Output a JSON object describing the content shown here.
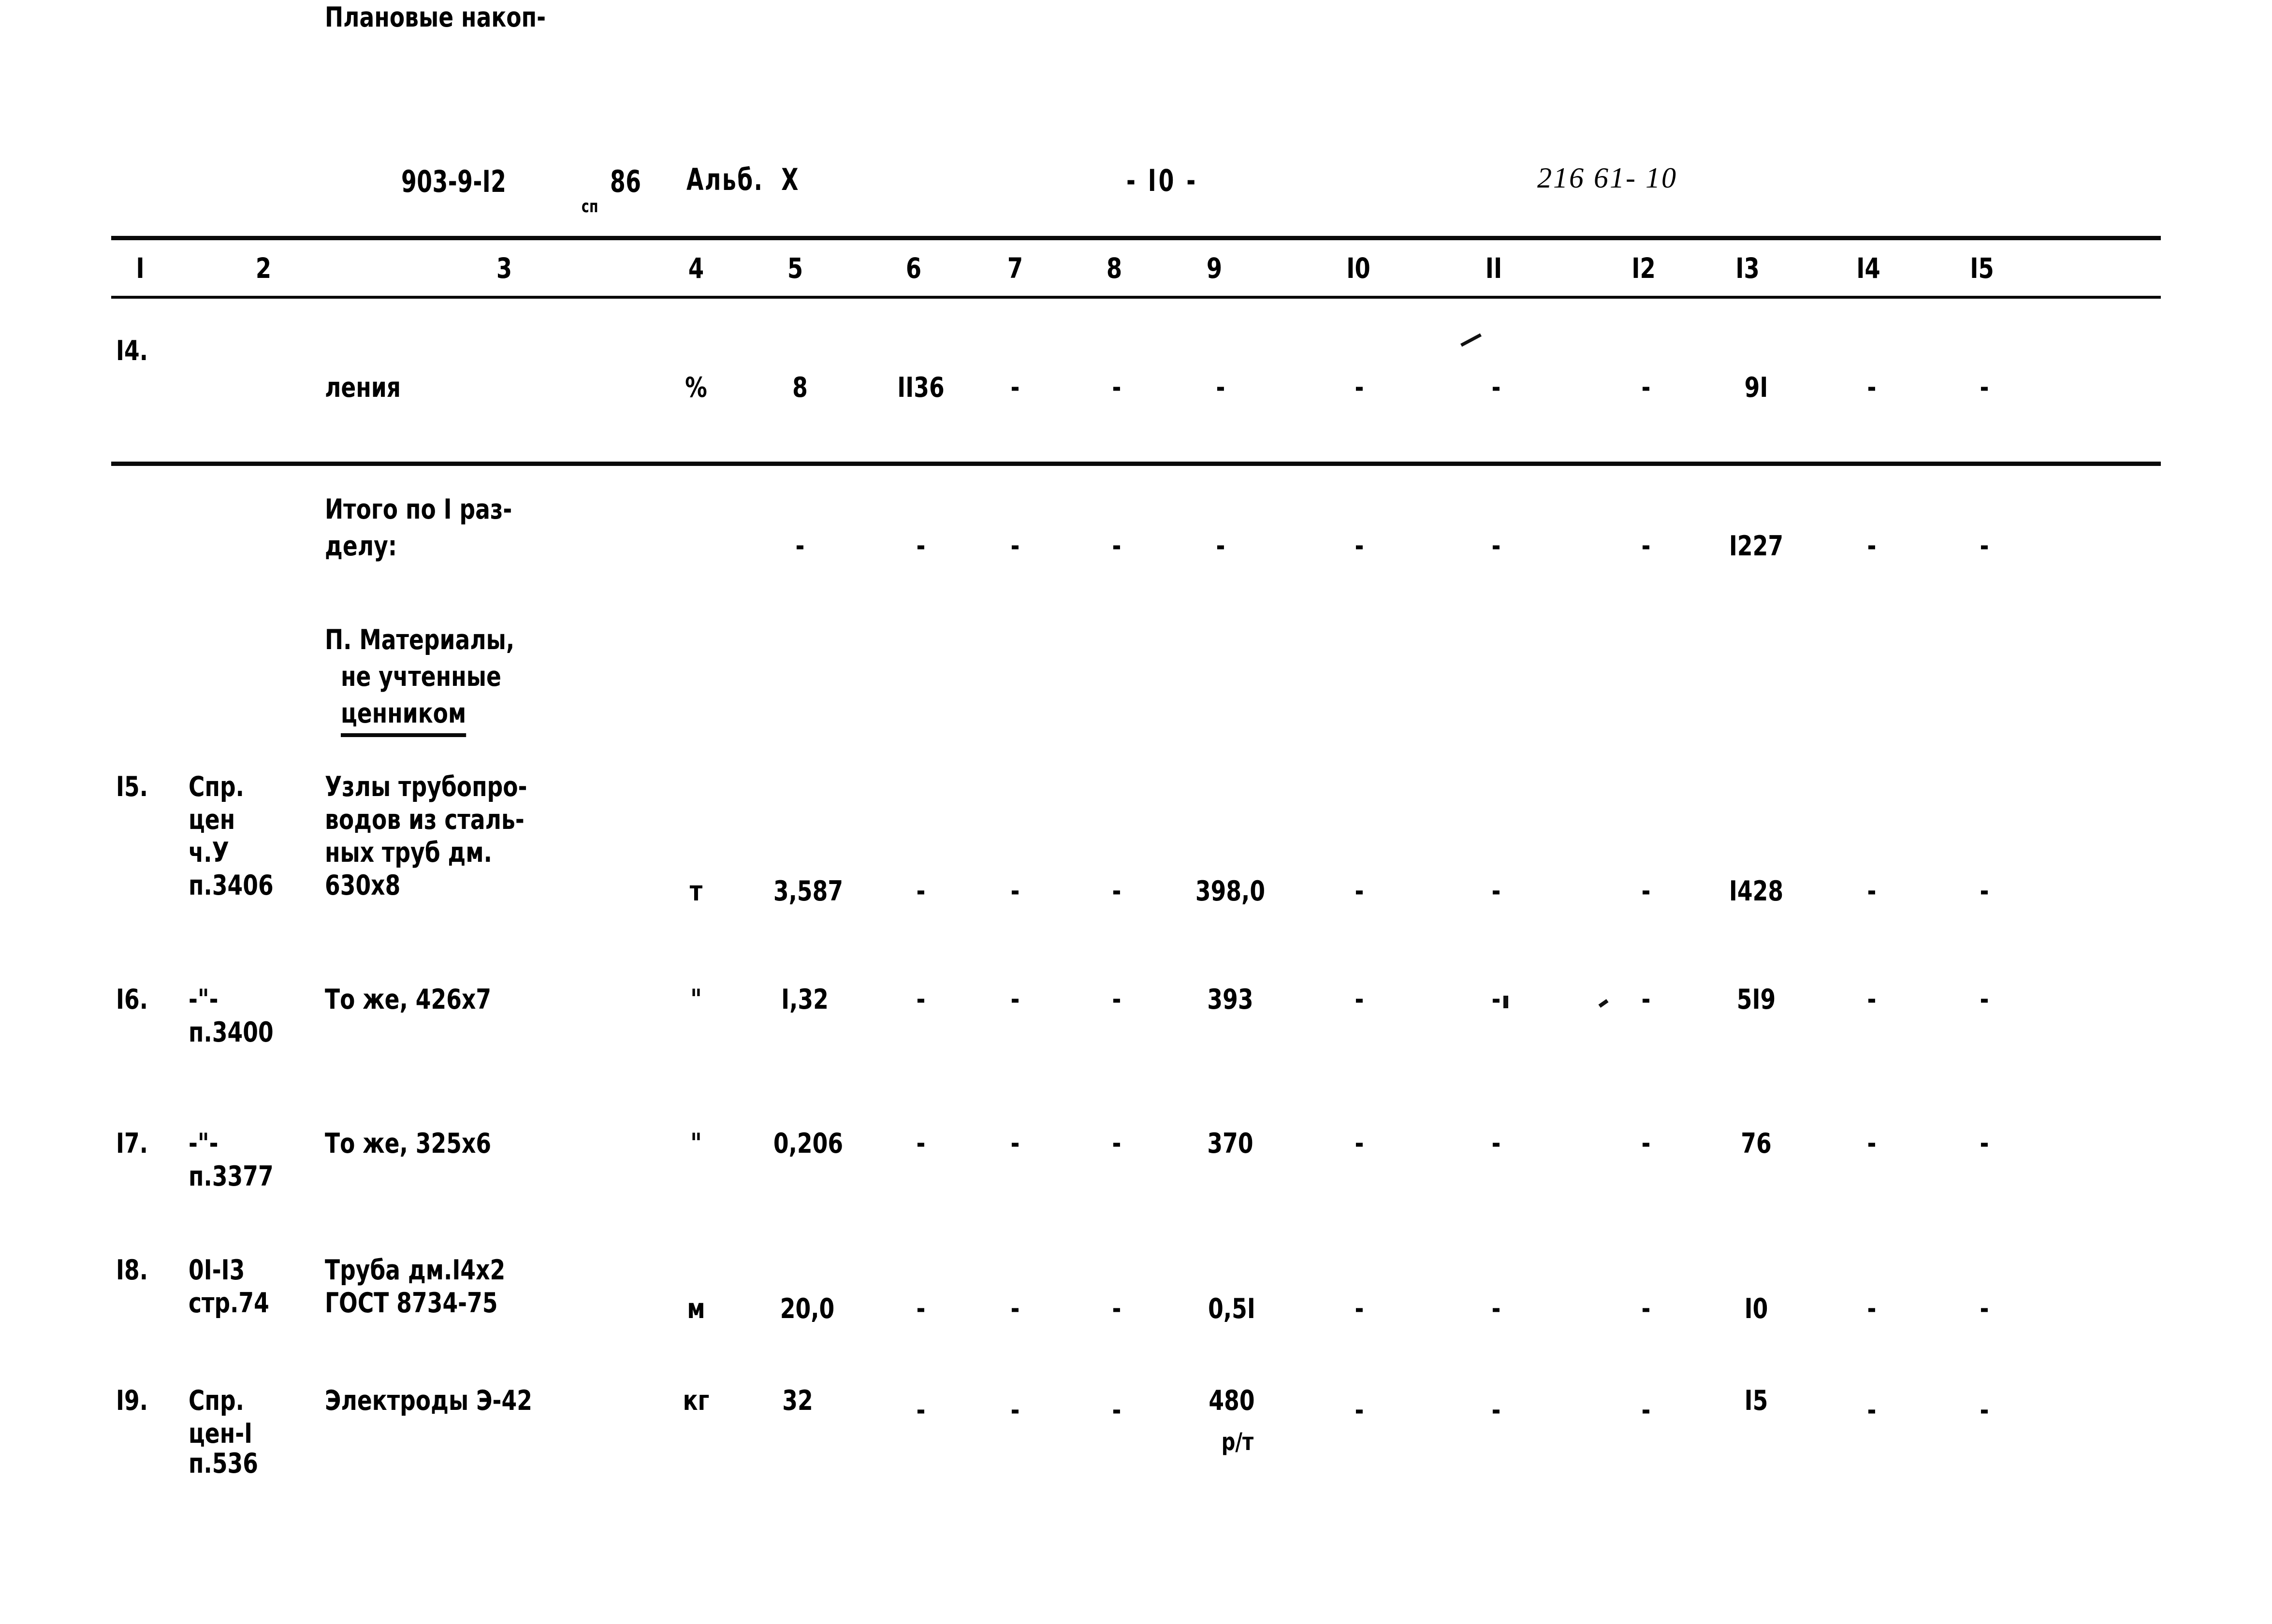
{
  "header": {
    "doc_code": "903-9-I2",
    "doc_code_sub": "сп",
    "doc_year": "86",
    "album": "Альб.  Х",
    "page": "- I0 -",
    "stamp": "216 61- 10"
  },
  "table": {
    "column_numbers": [
      "I",
      "2",
      "3",
      "4",
      "5",
      "6",
      "7",
      "8",
      "9",
      "I0",
      "II",
      "I2",
      "I3",
      "I4",
      "I5"
    ],
    "dash": "-",
    "rows": [
      {
        "id": "row-14",
        "num": "I4.",
        "ref": "",
        "name_lines": [
          "Плановые накоп-",
          "ления"
        ],
        "unit": "%",
        "c5": "8",
        "c6": "II36",
        "c7": "-",
        "c8": "-",
        "c9": "-",
        "c10": "-",
        "c11": "-",
        "c12": "-",
        "c13": "9I",
        "c14": "-",
        "c15": "-"
      },
      {
        "id": "row-total-1",
        "num": "",
        "ref": "",
        "name_lines": [
          "Итого по I раз-",
          "делу:"
        ],
        "unit": "",
        "c5": "-",
        "c6": "-",
        "c7": "-",
        "c8": "-",
        "c9": "-",
        "c10": "-",
        "c11": "-",
        "c12": "-",
        "c13": "I227",
        "c14": "-",
        "c15": "-"
      },
      {
        "id": "row-section-2",
        "num": "",
        "ref": "",
        "name_lines": [
          "П. Материалы,",
          "не учтенные",
          "ценником"
        ],
        "unit": "",
        "c5": "",
        "c6": "",
        "c7": "",
        "c8": "",
        "c9": "",
        "c10": "",
        "c11": "",
        "c12": "",
        "c13": "",
        "c14": "",
        "c15": ""
      },
      {
        "id": "row-15",
        "num": "I5.",
        "ref_lines": [
          "Спр.",
          "цен",
          "ч.У",
          "п.3406"
        ],
        "name_lines": [
          "Узлы трубопро-",
          "водов из сталь-",
          "ных труб дм.",
          "630х8"
        ],
        "unit": "т",
        "c5": "3,587",
        "c6": "-",
        "c7": "-",
        "c8": "-",
        "c9": "398,0",
        "c10": "-",
        "c11": "-",
        "c12": "-",
        "c13": "I428",
        "c14": "-",
        "c15": "-"
      },
      {
        "id": "row-16",
        "num": "I6.",
        "ref_lines": [
          "-\"-",
          "п.3400"
        ],
        "name_lines": [
          "То же, 426х7"
        ],
        "unit": "\"",
        "c5": "I,32",
        "c6": "-",
        "c7": "-",
        "c8": "-",
        "c9": "393",
        "c10": "-",
        "c11": "-",
        "c12": "-",
        "c13": "5I9",
        "c14": "-",
        "c15": "-"
      },
      {
        "id": "row-17",
        "num": "I7.",
        "ref_lines": [
          "-\"-",
          "п.3377"
        ],
        "name_lines": [
          "То же, 325х6"
        ],
        "unit": "\"",
        "c5": "0,206",
        "c6": "-",
        "c7": "-",
        "c8": "-",
        "c9": "370",
        "c10": "-",
        "c11": "-",
        "c12": "-",
        "c13": "76",
        "c14": "-",
        "c15": "-"
      },
      {
        "id": "row-18",
        "num": "I8.",
        "ref_lines": [
          "0I-I3",
          "стр.74"
        ],
        "name_lines": [
          "Труба дм.I4х2",
          "ГОСТ 8734-75"
        ],
        "unit": "м",
        "c5": "20,0",
        "c6": "-",
        "c7": "-",
        "c8": "-",
        "c9": "0,5I",
        "c10": "-",
        "c11": "-",
        "c12": "-",
        "c13": "I0",
        "c14": "-",
        "c15": "-"
      },
      {
        "id": "row-19",
        "num": "I9.",
        "ref_lines": [
          "Спр.",
          "цен-I",
          "п.536"
        ],
        "name_lines": [
          "Электроды Э-42"
        ],
        "unit": "кг",
        "c5": "32",
        "c6": "-",
        "c7": "-",
        "c8": "-",
        "c9": "480",
        "c9_sub": "р/т",
        "c10": "-",
        "c11": "-",
        "c12": "-",
        "c13": "I5",
        "c14": "-",
        "c15": "-"
      }
    ]
  }
}
